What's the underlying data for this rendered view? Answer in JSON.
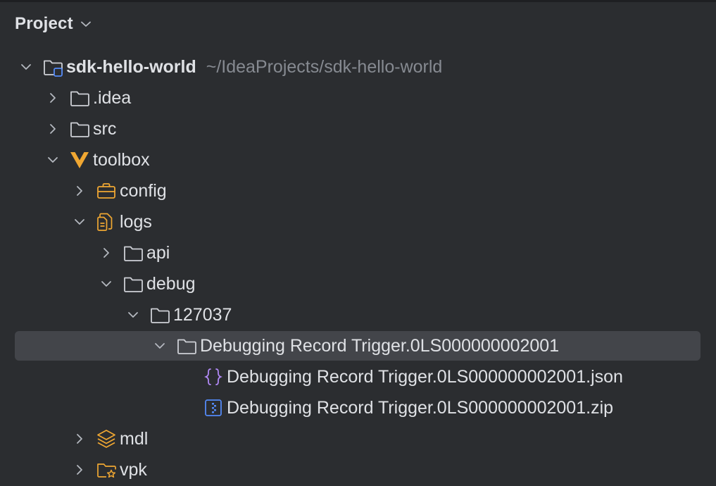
{
  "panel": {
    "title": "Project"
  },
  "tree": {
    "root": {
      "label": "sdk-hello-world",
      "path": "~/IdeaProjects/sdk-hello-world"
    },
    "items": [
      {
        "label": ".idea",
        "icon": "folder-icon",
        "expanded": false
      },
      {
        "label": "src",
        "icon": "folder-icon",
        "expanded": false
      },
      {
        "label": "toolbox",
        "icon": "vue-icon",
        "expanded": true
      },
      {
        "label": "config",
        "icon": "briefcase-icon",
        "expanded": false
      },
      {
        "label": "logs",
        "icon": "log-folder-icon",
        "expanded": true
      },
      {
        "label": "api",
        "icon": "folder-icon",
        "expanded": false
      },
      {
        "label": "debug",
        "icon": "folder-icon",
        "expanded": true
      },
      {
        "label": "127037",
        "icon": "folder-icon",
        "expanded": true
      },
      {
        "label": "Debugging Record Trigger.0LS000000002001",
        "icon": "folder-icon",
        "expanded": true,
        "selected": true
      },
      {
        "label": "Debugging Record Trigger.0LS000000002001.json",
        "icon": "json-file-icon"
      },
      {
        "label": "Debugging Record Trigger.0LS000000002001.zip",
        "icon": "zip-file-icon"
      },
      {
        "label": "mdl",
        "icon": "layers-icon",
        "expanded": false
      },
      {
        "label": "vpk",
        "icon": "star-folder-icon",
        "expanded": false
      }
    ]
  },
  "colors": {
    "background": "#2b2d30",
    "selection": "#43454a",
    "text": "#dfe1e5",
    "muted": "#868a91",
    "accent_orange": "#f0a732",
    "accent_blue": "#548af7",
    "accent_purple": "#b189f5"
  }
}
